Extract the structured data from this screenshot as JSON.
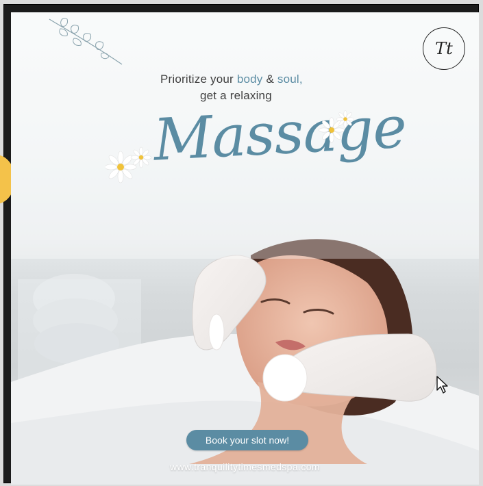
{
  "poster": {
    "headline_line1_prefix": "Prioritize your ",
    "headline_line1_body": "body",
    "headline_line1_mid": " & ",
    "headline_line1_soul": "soul,",
    "headline_line2": "get a relaxing",
    "script_word": "Massage",
    "logo_text": "Tt",
    "cta_label": "Book your slot now!",
    "url": "www.tranquilitytimesmedspa.com"
  },
  "colors": {
    "accent": "#5b8ca3",
    "text_dark": "#3f3f3f",
    "cta_text": "#ffffff",
    "side_dot": "#f4c24a"
  },
  "icons": {
    "logo": "monogram-logo",
    "flower": "daisy-icon",
    "leaves": "leaf-branch-icon",
    "cursor": "mouse-pointer-icon"
  }
}
